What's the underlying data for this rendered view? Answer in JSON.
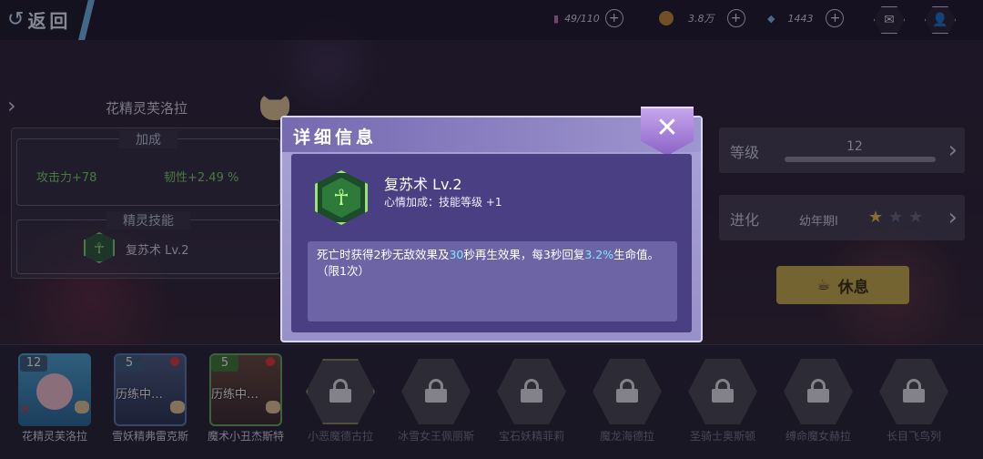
{
  "topbar": {
    "back_label": "返回",
    "stamina": "49/110",
    "coins": "3.8万",
    "gems": "1443",
    "plus": "+",
    "mail_icon": "✉",
    "profile_icon": "👤"
  },
  "left": {
    "pet_name": "花精灵芙洛拉",
    "bonus_title": "加成",
    "attack": "攻击力+78",
    "toughness": "韧性+2.49 %",
    "skill_title": "精灵技能",
    "skill_name": "复苏术 Lv.2"
  },
  "right": {
    "level_label": "等级",
    "level_value": "12",
    "level_progress_pct": 100,
    "evolve_label": "进化",
    "stage": "幼年期Ⅰ",
    "stars_filled": 1,
    "stars_total": 3,
    "rest_label": "休息"
  },
  "modal": {
    "title": "详细信息",
    "close": "✕",
    "skill_name": "复苏术 Lv.2",
    "skill_sub": "心情加成：技能等级 +1",
    "desc_a": "死亡时获得2秒无敌效果及",
    "desc_hl1": "30",
    "desc_b": "秒再生效果，每3秒回复",
    "desc_hl2": "3.2%",
    "desc_c": "生命值。",
    "desc_line2": "（限1次）"
  },
  "characters": [
    {
      "name": "花精灵芙洛拉",
      "level": "12",
      "status": "",
      "locked": false
    },
    {
      "name": "雪妖精弗雷克斯",
      "level": "5",
      "status": "历练中…",
      "locked": false
    },
    {
      "name": "魔术小丑杰斯特",
      "level": "5",
      "status": "历练中…",
      "locked": false
    },
    {
      "name": "小恶魔德古拉",
      "locked": true
    },
    {
      "name": "冰雪女王佩丽斯",
      "locked": true
    },
    {
      "name": "宝石妖精菲莉",
      "locked": true
    },
    {
      "name": "魔龙海德拉",
      "locked": true
    },
    {
      "name": "圣骑士奥斯顿",
      "locked": true
    },
    {
      "name": "缚命魔女赫拉",
      "locked": true
    },
    {
      "name": "长目飞鸟列",
      "locked": true
    }
  ],
  "colors": {
    "accent_blue": "#6fb7e5",
    "stat_green": "#7fd36b",
    "highlight_cyan": "#7ee7ff",
    "rest_gold": "#c9b04e",
    "modal_purple": "#4a3f83"
  }
}
